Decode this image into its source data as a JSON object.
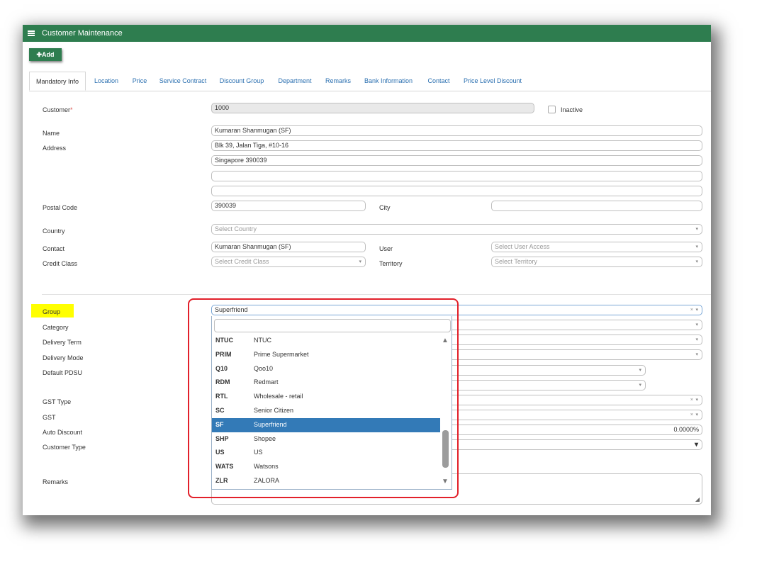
{
  "window": {
    "title": "Customer Maintenance"
  },
  "toolbar": {
    "add_label": "✚Add"
  },
  "tabs": [
    {
      "label": "Mandatory Info"
    },
    {
      "label": "Location"
    },
    {
      "label": "Price"
    },
    {
      "label": "Service Contract"
    },
    {
      "label": "Discount Group"
    },
    {
      "label": "Department"
    },
    {
      "label": "Remarks"
    },
    {
      "label": "Bank Information"
    },
    {
      "label": "Contact"
    },
    {
      "label": "Price Level Discount"
    }
  ],
  "form": {
    "customer_label": "Customer",
    "customer_required": "*",
    "customer_value": "1000",
    "inactive_label": "Inactive",
    "name_label": "Name",
    "name_value": "Kumaran Shanmugan (SF)",
    "address_label": "Address",
    "address1": "Blk 39, Jalan Tiga, #10-16",
    "address2": "Singapore 390039",
    "postal_label": "Postal Code",
    "postal_value": "390039",
    "city_label": "City",
    "country_label": "Country",
    "country_placeholder": "Select Country",
    "contact_label": "Contact",
    "contact_value": "Kumaran Shanmugan (SF)",
    "user_label": "User",
    "user_placeholder": "Select User Access",
    "credit_label": "Credit Class",
    "credit_placeholder": "Select Credit Class",
    "territory_label": "Territory",
    "territory_placeholder": "Select Territory",
    "group_label": "Group",
    "group_value": "Superfriend",
    "category_label": "Category",
    "delivery_term_label": "Delivery Term",
    "delivery_mode_label": "Delivery Mode",
    "pdsu_label": "Default PDSU",
    "gst_type_label": "GST Type",
    "gst_label": "GST",
    "auto_discount_label": "Auto Discount",
    "auto_discount_value": "0.0000%",
    "customer_type_label": "Customer Type",
    "remarks_label": "Remarks",
    "clear_symbol": "×",
    "arrow_symbol": "▾"
  },
  "dropdown": {
    "items": [
      {
        "code": "NTUC",
        "name": "NTUC"
      },
      {
        "code": "PRIM",
        "name": "Prime Supermarket"
      },
      {
        "code": "Q10",
        "name": "Qoo10"
      },
      {
        "code": "RDM",
        "name": "Redmart"
      },
      {
        "code": "RTL",
        "name": "Wholesale - retail"
      },
      {
        "code": "SC",
        "name": "Senior Citizen"
      },
      {
        "code": "SF",
        "name": "Superfriend",
        "selected": true
      },
      {
        "code": "SHP",
        "name": "Shopee"
      },
      {
        "code": "US",
        "name": "US"
      },
      {
        "code": "WATS",
        "name": "Watsons"
      },
      {
        "code": "ZLR",
        "name": "ZALORA"
      }
    ]
  },
  "colors": {
    "brand": "#2e7d4f",
    "selected": "#337ab7",
    "callout": "#e2202a",
    "highlight": "#ffff00"
  }
}
